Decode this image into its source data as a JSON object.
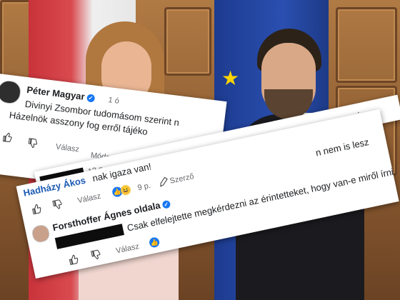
{
  "post1": {
    "author": "Péter Magyar",
    "time": "1 ó",
    "line1": "Divinyi Zsombor tudomásom szerint n",
    "line2": "Házelnök asszony fog erről tájéko",
    "reply": "Válasz",
    "modified": "Módosí"
  },
  "post2": {
    "time": "12 p.",
    "author": "Hadházy Ákos",
    "text": "nak igaza van!",
    "reply": "Válasz",
    "age": "9 p.",
    "author_tag": "Szerző",
    "right_text1": "n nem is lesz",
    "right_text2": "i"
  },
  "post3": {
    "author": "Forsthoffer Ágnes oldala",
    "text": "Csak elfelejtette megkérdezni az érintetteket, hogy van-e miről írni",
    "reply": "Válasz"
  },
  "icons": {
    "like": "thumbs-up-icon",
    "dislike": "thumbs-down-icon",
    "verified": "verified-badge-icon",
    "pen": "pen-icon"
  },
  "colors": {
    "link_blue": "#1e5bb5",
    "facebook_blue": "#1877f2",
    "flag_red": "#c8333a",
    "eu_blue": "#1d3b8f"
  }
}
